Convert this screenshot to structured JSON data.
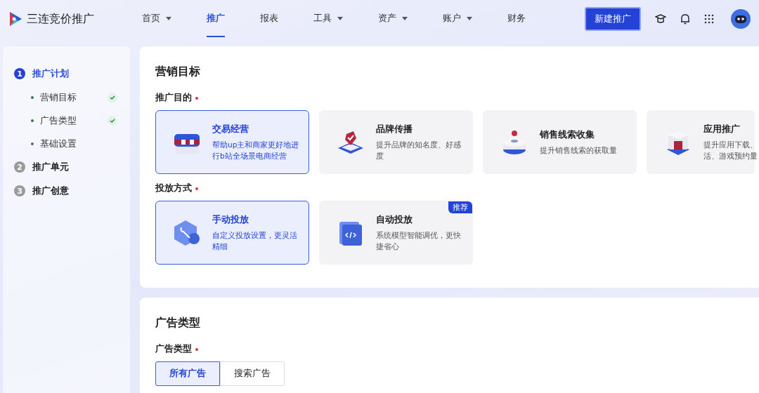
{
  "header": {
    "logo": "三连竞价推广",
    "nav": [
      {
        "label": "首页",
        "dropdown": true,
        "selected": false
      },
      {
        "label": "推广",
        "dropdown": false,
        "selected": true
      },
      {
        "label": "报表",
        "dropdown": false,
        "selected": false
      },
      {
        "label": "工具",
        "dropdown": true,
        "selected": false
      },
      {
        "label": "资产",
        "dropdown": true,
        "selected": false
      },
      {
        "label": "账户",
        "dropdown": true,
        "selected": false
      },
      {
        "label": "财务",
        "dropdown": false,
        "selected": false
      }
    ],
    "primary_button": "新建推广"
  },
  "sidebar": {
    "steps": [
      {
        "number": "1",
        "label": "推广计划",
        "selected": true,
        "children": [
          {
            "label": "营销目标",
            "done": true
          },
          {
            "label": "广告类型",
            "done": true
          },
          {
            "label": "基础设置",
            "done": false
          }
        ]
      },
      {
        "number": "2",
        "label": "推广单元",
        "selected": false
      },
      {
        "number": "3",
        "label": "推广创意",
        "selected": false
      }
    ]
  },
  "marketing_goal": {
    "title": "营销目标",
    "purpose": {
      "label": "推广目的",
      "required": true,
      "options": [
        {
          "kind": "box",
          "title": "交易经营",
          "desc": [
            "帮助up主和商家更好地进",
            "行b站全场景电商经营"
          ],
          "selected": true
        },
        {
          "kind": "tag",
          "title": "品牌传播",
          "desc": [
            "提升品牌的知名度、好感",
            "度"
          ],
          "selected": false
        },
        {
          "kind": "disc",
          "title": "销售线索收集",
          "desc": [
            "提升销售线索的获取量"
          ],
          "selected": false
        },
        {
          "kind": "cube",
          "title": "应用推广",
          "desc": [
            "提升应用下载、",
            "活、游戏预约量"
          ],
          "selected": false
        }
      ]
    },
    "method": {
      "label": "投放方式",
      "required": true,
      "options": [
        {
          "kind": "wrench",
          "title": "手动投放",
          "desc": [
            "自定义投放设置，更灵活",
            "精细"
          ],
          "selected": true
        },
        {
          "kind": "code",
          "title": "自动投放",
          "desc": [
            "系统模型智能调优，更快",
            "捷省心"
          ],
          "selected": false,
          "badge": "推荐"
        }
      ]
    }
  },
  "ad_type": {
    "title": "广告类型",
    "label": "广告类型",
    "required": true,
    "options": [
      {
        "label": "所有广告",
        "selected": true
      },
      {
        "label": "搜索广告",
        "selected": false
      }
    ]
  }
}
